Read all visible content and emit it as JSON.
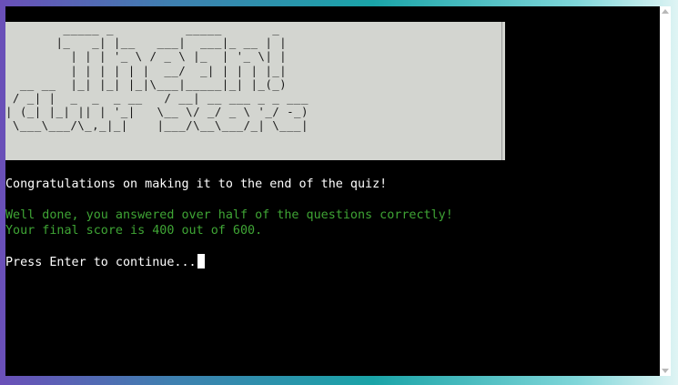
{
  "terminal": {
    "banner_ascii": "        _____ _          _____       _\n       |_   _| |__   ___|  ___|_ __ | |\n         | | | '_ \\ / _ \\ |_  | '_ \\| |\n         | | | | | |  __/  _| | | | |_|\n  __ __  |_| |_| |_|\\___|_____|_| |_(_)\n / _| |  _  _  _ __   / __| __ ___ _ _ ___\n| (_| |_| || | '_|   \\__ \\/ _/ _ \\ '_/ -_)\n \\___\\___/\\_,_|_|    |___/\\__\\___/_| \\___|",
    "congrats_line": "Congratulations on making it to the end of the quiz!",
    "result_line1": "Well done, you answered over half of the questions correctly!",
    "result_line2": "Your final score is 400 out of 600.",
    "prompt_line": "Press Enter to continue..."
  },
  "colors": {
    "background": "#000000",
    "banner_bg": "#d3d5d0",
    "default_text": "#ffffff",
    "success_text": "#3fa535"
  },
  "icons": {
    "scroll_up": "scroll-up-arrow-icon",
    "scroll_down": "scroll-down-arrow-icon"
  }
}
